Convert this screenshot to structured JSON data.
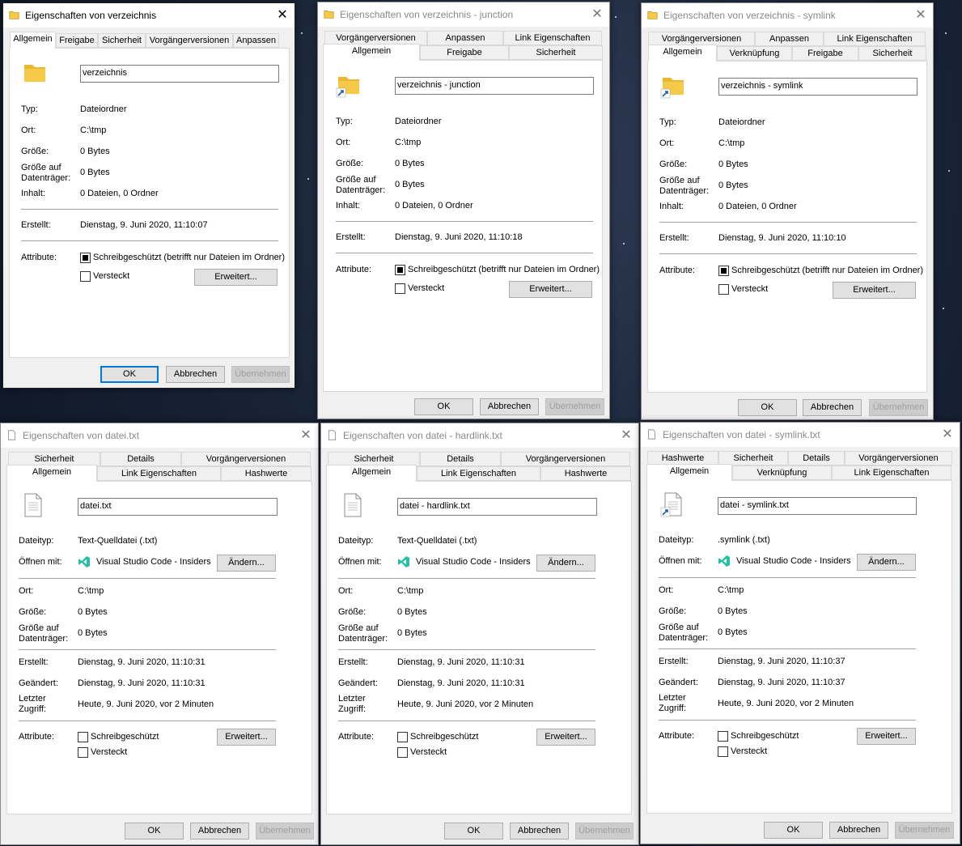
{
  "dialogs": {
    "d1": {
      "title": "Eigenschaften von verzeichnis",
      "tabs_back": [],
      "tabs_front": [
        "Allgemein",
        "Freigabe",
        "Sicherheit",
        "Vorgängerversionen",
        "Anpassen"
      ],
      "name": "verzeichnis",
      "rows": {
        "typ": {
          "label": "Typ:",
          "value": "Dateiordner"
        },
        "ort": {
          "label": "Ort:",
          "value": "C:\\tmp"
        },
        "groesse": {
          "label": "Größe:",
          "value": "0 Bytes"
        },
        "groesse_dt": {
          "label1": "Größe auf",
          "label2": "Datenträger:",
          "value": "0 Bytes"
        },
        "inhalt": {
          "label": "Inhalt:",
          "value": "0 Dateien, 0 Ordner"
        },
        "erstellt": {
          "label": "Erstellt:",
          "value": "Dienstag, 9. Juni 2020, 11:10:07"
        }
      },
      "attr_label": "Attribute:",
      "readonly_label": "Schreibgeschützt (betrifft nur Dateien im Ordner)",
      "hidden_label": "Versteckt",
      "advanced": "Erweitert...",
      "ok": "OK",
      "cancel": "Abbrechen",
      "apply": "Übernehmen"
    },
    "d2": {
      "title": "Eigenschaften von verzeichnis - junction",
      "tabs_back": [
        "Vorgängerversionen",
        "Anpassen",
        "Link Eigenschaften"
      ],
      "tabs_front": [
        "Allgemein",
        "Freigabe",
        "Sicherheit"
      ],
      "name": "verzeichnis - junction",
      "rows": {
        "typ": {
          "label": "Typ:",
          "value": "Dateiordner"
        },
        "ort": {
          "label": "Ort:",
          "value": "C:\\tmp"
        },
        "groesse": {
          "label": "Größe:",
          "value": "0 Bytes"
        },
        "groesse_dt": {
          "label1": "Größe auf",
          "label2": "Datenträger:",
          "value": "0 Bytes"
        },
        "inhalt": {
          "label": "Inhalt:",
          "value": "0 Dateien, 0 Ordner"
        },
        "erstellt": {
          "label": "Erstellt:",
          "value": "Dienstag, 9. Juni 2020, 11:10:18"
        }
      },
      "attr_label": "Attribute:",
      "readonly_label": "Schreibgeschützt (betrifft nur Dateien im Ordner)",
      "hidden_label": "Versteckt",
      "advanced": "Erweitert...",
      "ok": "OK",
      "cancel": "Abbrechen",
      "apply": "Übernehmen"
    },
    "d3": {
      "title": "Eigenschaften von verzeichnis - symlink",
      "tabs_back": [
        "Vorgängerversionen",
        "Anpassen",
        "Link Eigenschaften"
      ],
      "tabs_front": [
        "Allgemein",
        "Verknüpfung",
        "Freigabe",
        "Sicherheit"
      ],
      "name": "verzeichnis - symlink",
      "rows": {
        "typ": {
          "label": "Typ:",
          "value": "Dateiordner"
        },
        "ort": {
          "label": "Ort:",
          "value": "C:\\tmp"
        },
        "groesse": {
          "label": "Größe:",
          "value": "0 Bytes"
        },
        "groesse_dt": {
          "label1": "Größe auf",
          "label2": "Datenträger:",
          "value": "0 Bytes"
        },
        "inhalt": {
          "label": "Inhalt:",
          "value": "0 Dateien, 0 Ordner"
        },
        "erstellt": {
          "label": "Erstellt:",
          "value": "Dienstag, 9. Juni 2020, 11:10:10"
        }
      },
      "attr_label": "Attribute:",
      "readonly_label": "Schreibgeschützt (betrifft nur Dateien im Ordner)",
      "hidden_label": "Versteckt",
      "advanced": "Erweitert...",
      "ok": "OK",
      "cancel": "Abbrechen",
      "apply": "Übernehmen"
    },
    "f1": {
      "title": "Eigenschaften von datei.txt",
      "tabs_back": [
        "Sicherheit",
        "Details",
        "Vorgängerversionen"
      ],
      "tabs_front": [
        "Allgemein",
        "Link Eigenschaften",
        "Hashwerte"
      ],
      "name": "datei.txt",
      "rows": {
        "dateityp": {
          "label": "Dateityp:",
          "value": "Text-Quelldatei (.txt)"
        },
        "oeffnen": {
          "label": "Öffnen mit:",
          "value": "Visual Studio Code - Insiders",
          "button": "Ändern..."
        },
        "ort": {
          "label": "Ort:",
          "value": "C:\\tmp"
        },
        "groesse": {
          "label": "Größe:",
          "value": "0 Bytes"
        },
        "groesse_dt": {
          "label1": "Größe auf",
          "label2": "Datenträger:",
          "value": "0 Bytes"
        },
        "erstellt": {
          "label": "Erstellt:",
          "value": "Dienstag, 9. Juni 2020, 11:10:31"
        },
        "geaendert": {
          "label": "Geändert:",
          "value": "Dienstag, 9. Juni 2020, 11:10:31"
        },
        "zugriff": {
          "label1": "Letzter",
          "label2": "Zugriff:",
          "value": "Heute, 9. Juni 2020, vor 2 Minuten"
        }
      },
      "attr_label": "Attribute:",
      "readonly_label": "Schreibgeschützt",
      "hidden_label": "Versteckt",
      "advanced": "Erweitert...",
      "ok": "OK",
      "cancel": "Abbrechen",
      "apply": "Übernehmen"
    },
    "f2": {
      "title": "Eigenschaften von datei - hardlink.txt",
      "tabs_back": [
        "Sicherheit",
        "Details",
        "Vorgängerversionen"
      ],
      "tabs_front": [
        "Allgemein",
        "Link Eigenschaften",
        "Hashwerte"
      ],
      "name": "datei - hardlink.txt",
      "rows": {
        "dateityp": {
          "label": "Dateityp:",
          "value": "Text-Quelldatei (.txt)"
        },
        "oeffnen": {
          "label": "Öffnen mit:",
          "value": "Visual Studio Code - Insiders",
          "button": "Ändern..."
        },
        "ort": {
          "label": "Ort:",
          "value": "C:\\tmp"
        },
        "groesse": {
          "label": "Größe:",
          "value": "0 Bytes"
        },
        "groesse_dt": {
          "label1": "Größe auf",
          "label2": "Datenträger:",
          "value": "0 Bytes"
        },
        "erstellt": {
          "label": "Erstellt:",
          "value": "Dienstag, 9. Juni 2020, 11:10:31"
        },
        "geaendert": {
          "label": "Geändert:",
          "value": "Dienstag, 9. Juni 2020, 11:10:31"
        },
        "zugriff": {
          "label1": "Letzter",
          "label2": "Zugriff:",
          "value": "Heute, 9. Juni 2020, vor 2 Minuten"
        }
      },
      "attr_label": "Attribute:",
      "readonly_label": "Schreibgeschützt",
      "hidden_label": "Versteckt",
      "advanced": "Erweitert...",
      "ok": "OK",
      "cancel": "Abbrechen",
      "apply": "Übernehmen"
    },
    "f3": {
      "title": "Eigenschaften von datei - symlink.txt",
      "tabs_back": [
        "Hashwerte",
        "Sicherheit",
        "Details",
        "Vorgängerversionen"
      ],
      "tabs_front": [
        "Allgemein",
        "Verknüpfung",
        "Link Eigenschaften"
      ],
      "name": "datei - symlink.txt",
      "rows": {
        "dateityp": {
          "label": "Dateityp:",
          "value": ".symlink (.txt)"
        },
        "oeffnen": {
          "label": "Öffnen mit:",
          "value": "Visual Studio Code - Insiders",
          "button": "Ändern..."
        },
        "ort": {
          "label": "Ort:",
          "value": "C:\\tmp"
        },
        "groesse": {
          "label": "Größe:",
          "value": "0 Bytes"
        },
        "groesse_dt": {
          "label1": "Größe auf",
          "label2": "Datenträger:",
          "value": "0 Bytes"
        },
        "erstellt": {
          "label": "Erstellt:",
          "value": "Dienstag, 9. Juni 2020, 11:10:37"
        },
        "geaendert": {
          "label": "Geändert:",
          "value": "Dienstag, 9. Juni 2020, 11:10:37"
        },
        "zugriff": {
          "label1": "Letzter",
          "label2": "Zugriff:",
          "value": "Heute, 9. Juni 2020, vor 2 Minuten"
        }
      },
      "attr_label": "Attribute:",
      "readonly_label": "Schreibgeschützt",
      "hidden_label": "Versteckt",
      "advanced": "Erweitert...",
      "ok": "OK",
      "cancel": "Abbrechen",
      "apply": "Übernehmen"
    }
  },
  "icons": {
    "folder": "folder-icon",
    "file": "text-file-icon",
    "shortcut_overlay": "shortcut-arrow-icon",
    "vscode": "vscode-insiders-icon",
    "close": "close-icon"
  },
  "colors": {
    "dialog_bg": "#f0f0f0",
    "default_button_border": "#0078d7",
    "folder_yellow": "#f7c948",
    "vscode_green": "#24bfa5"
  }
}
